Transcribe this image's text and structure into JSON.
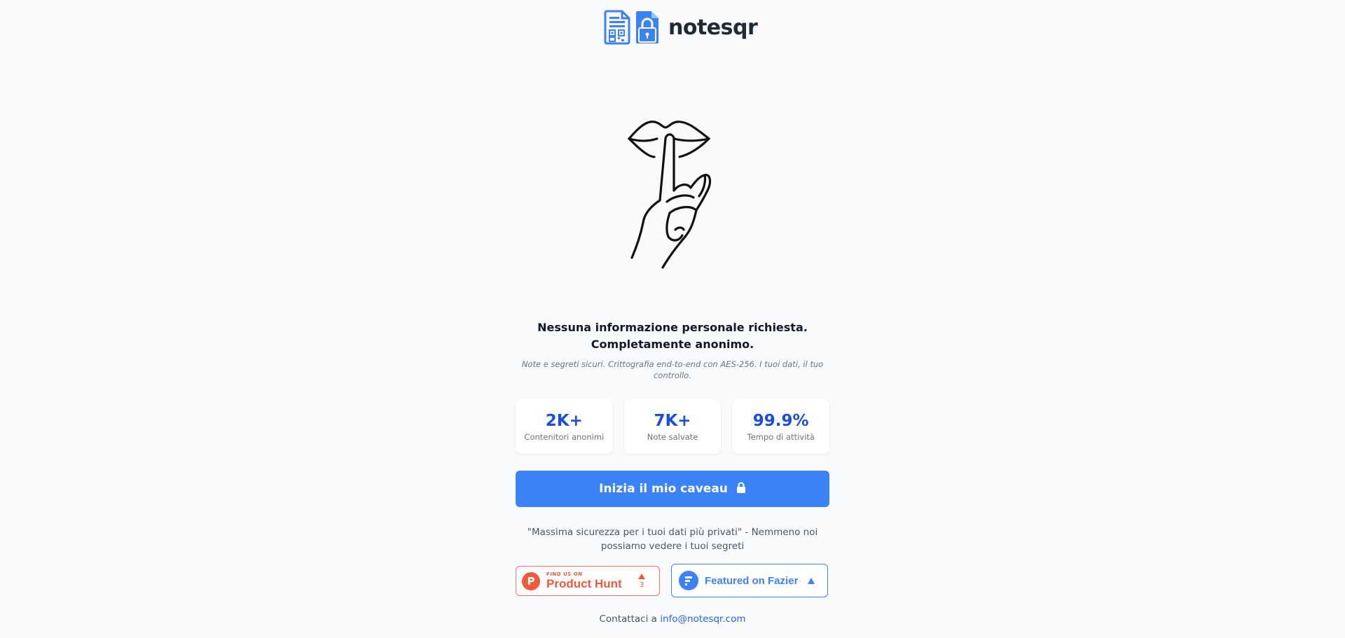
{
  "header": {
    "logo_text": "notesqr",
    "icons": [
      "qr-document-icon",
      "lock-document-icon"
    ]
  },
  "hero": {
    "illustration": "shush-gesture-icon"
  },
  "main": {
    "headline": "Nessuna informazione personale richiesta. Completamente anonimo.",
    "subtitle": "Note e segreti sicuri. Crittografia end-to-end con AES-256. I tuoi dati, il tuo controllo.",
    "stats": [
      {
        "value": "2K+",
        "label": "Contenitori anonimi"
      },
      {
        "value": "7K+",
        "label": "Note salvate"
      },
      {
        "value": "99.9%",
        "label": "Tempo di attività"
      }
    ],
    "cta_label": "Inizia il mio caveau",
    "cta_icon": "lock-icon",
    "quote": "\"Massima sicurezza per i tuoi dati più privati\" - Nemmeno noi possiamo vedere i tuoi segreti"
  },
  "badges": {
    "product_hunt": {
      "logo_letter": "P",
      "small_text": "FIND US ON",
      "big_text": "Product Hunt",
      "votes": "3"
    },
    "fazier": {
      "text": "Featured on Fazier"
    }
  },
  "footer": {
    "contact_prefix": "Contattaci a",
    "email": "info@notesqr.com"
  },
  "colors": {
    "background": "#f8fafc",
    "primary": "#3b82f6",
    "stat_value": "#1d4ed8",
    "product_hunt": "#ef5a3c"
  }
}
